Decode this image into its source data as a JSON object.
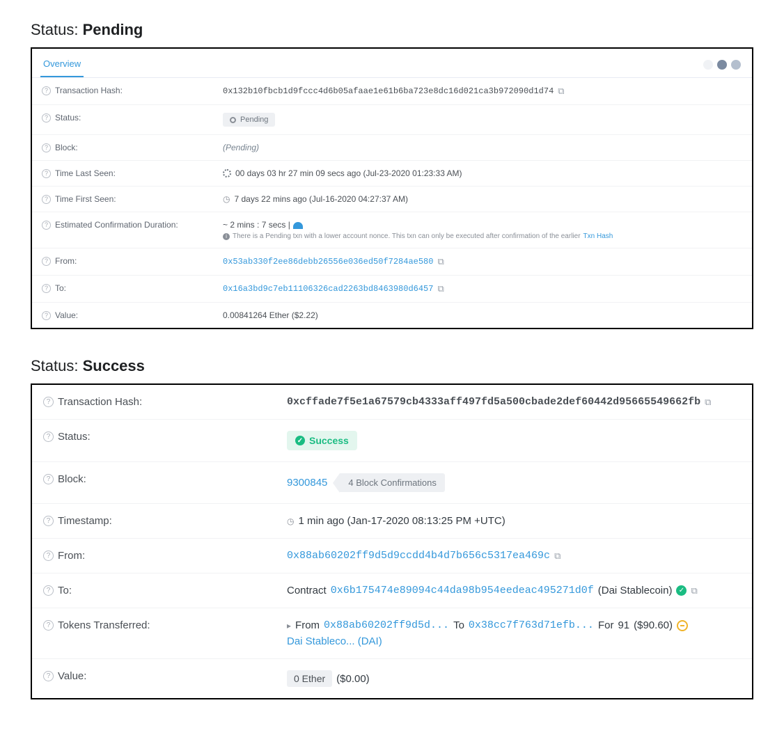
{
  "titles": {
    "pending_prefix": "Status: ",
    "pending_value": "Pending",
    "success_prefix": "Status: ",
    "success_value": "Success"
  },
  "pending": {
    "tab": "Overview",
    "labels": {
      "txhash": "Transaction Hash:",
      "status": "Status:",
      "block": "Block:",
      "last_seen": "Time Last Seen:",
      "first_seen": "Time First Seen:",
      "est_conf": "Estimated Confirmation Duration:",
      "from": "From:",
      "to": "To:",
      "value": "Value:"
    },
    "txhash": "0x132b10fbcb1d9fccc4d6b05afaae1e61b6ba723e8dc16d021ca3b972090d1d74",
    "status_text": "Pending",
    "block_text": "(Pending)",
    "last_seen_text": "00 days 03 hr 27 min 09 secs ago (Jul-23-2020 01:23:33 AM)",
    "first_seen_text": "7 days 22 mins ago (Jul-16-2020 04:27:37 AM)",
    "est_conf_text": "~ 2 mins : 7 secs | ",
    "est_conf_note_prefix": "There is a Pending txn with a lower account nonce. This txn can only be executed after confirmation of the earlier ",
    "est_conf_note_link": "Txn Hash",
    "from": "0x53ab330f2ee86debb26556e036ed50f7284ae580",
    "to": "0x16a3bd9c7eb11106326cad2263bd8463980d6457",
    "value": "0.00841264 Ether ($2.22)"
  },
  "success": {
    "labels": {
      "txhash": "Transaction Hash:",
      "status": "Status:",
      "block": "Block:",
      "timestamp": "Timestamp:",
      "from": "From:",
      "to": "To:",
      "tokens": "Tokens Transferred:",
      "value": "Value:"
    },
    "txhash": "0xcffade7f5e1a67579cb4333aff497fd5a500cbade2def60442d95665549662fb",
    "status_text": "Success",
    "block_number": "9300845",
    "block_confirmations": "4 Block Confirmations",
    "timestamp_text": "1 min ago (Jan-17-2020 08:13:25 PM +UTC)",
    "from": "0x88ab60202ff9d5d9ccdd4b4d7b656c5317ea469c",
    "to_prefix": "Contract",
    "to_addr": "0x6b175474e89094c44da98b954eedeac495271d0f",
    "to_suffix": "(Dai Stablecoin)",
    "tokens_from_label": "From",
    "tokens_from": "0x88ab60202ff9d5d...",
    "tokens_to_label": "To",
    "tokens_to": "0x38cc7f763d71efb...",
    "tokens_for_label": "For",
    "tokens_amount": "91",
    "tokens_usd": "($90.60)",
    "tokens_name": "Dai Stableco... (DAI)",
    "value_pill": "0 Ether",
    "value_usd": "($0.00)"
  }
}
